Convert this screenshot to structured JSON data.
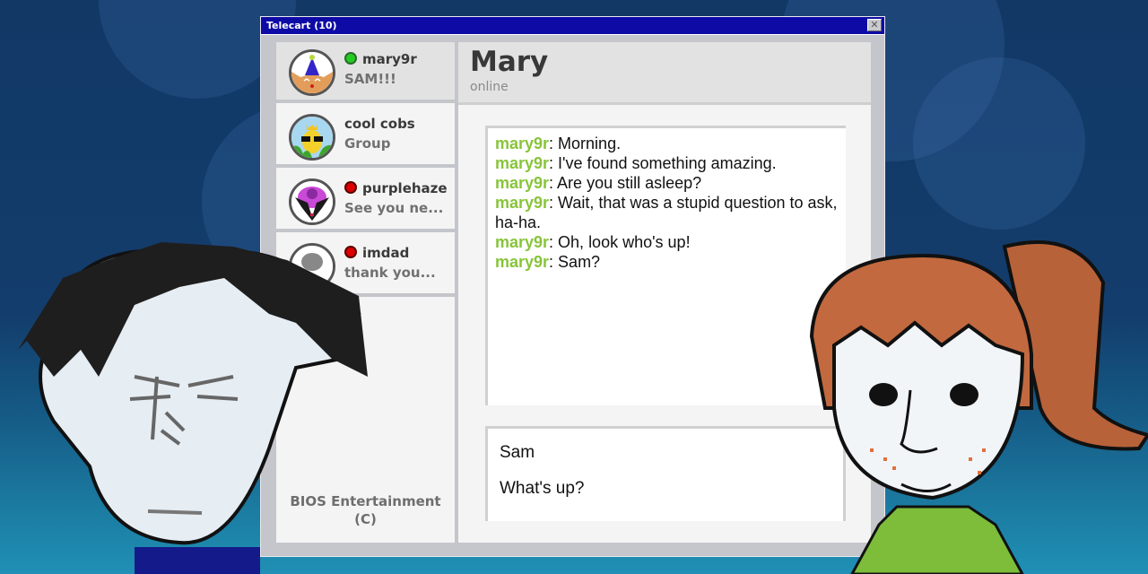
{
  "window": {
    "title": "Telecart (10)",
    "close_label": "✕"
  },
  "sidebar": {
    "contacts": [
      {
        "name": "mary9r",
        "preview": "SAM!!!",
        "status": "online",
        "status_color": "#22cc22",
        "avatar": "party-cat-avatar"
      },
      {
        "name": "cool cobs",
        "preview": "Group",
        "status": "none",
        "avatar": "corn-sunglasses-avatar"
      },
      {
        "name": "purplehaze",
        "preview": "See you ne...",
        "status": "offline",
        "status_color": "#dd0000",
        "avatar": "purple-creature-avatar"
      },
      {
        "name": "imdad",
        "preview": "thank you...",
        "status": "offline",
        "status_color": "#dd0000",
        "avatar": "dad-avatar"
      }
    ],
    "credits_line1": "BIOS Entertainment",
    "credits_line2": "(C)"
  },
  "chat": {
    "contact_name": "Mary",
    "contact_status": "online",
    "sender_color": "#88c43a",
    "messages": [
      {
        "sender": "mary9r",
        "text": ": Morning."
      },
      {
        "sender": "mary9r",
        "text": ": I've found something amazing."
      },
      {
        "sender": "mary9r",
        "text": ": Are you still asleep?"
      },
      {
        "sender": "mary9r",
        "text": ": Wait, that was a stupid question to ask, ha-ha."
      },
      {
        "sender": "mary9r",
        "text": ": Oh, look who's up!"
      },
      {
        "sender": "mary9r",
        "text": ": Sam?"
      }
    ],
    "reply_options": [
      "Sam",
      "What's up?"
    ]
  },
  "colors": {
    "titlebar": "#0e0aa6",
    "background": "#133d6c"
  }
}
